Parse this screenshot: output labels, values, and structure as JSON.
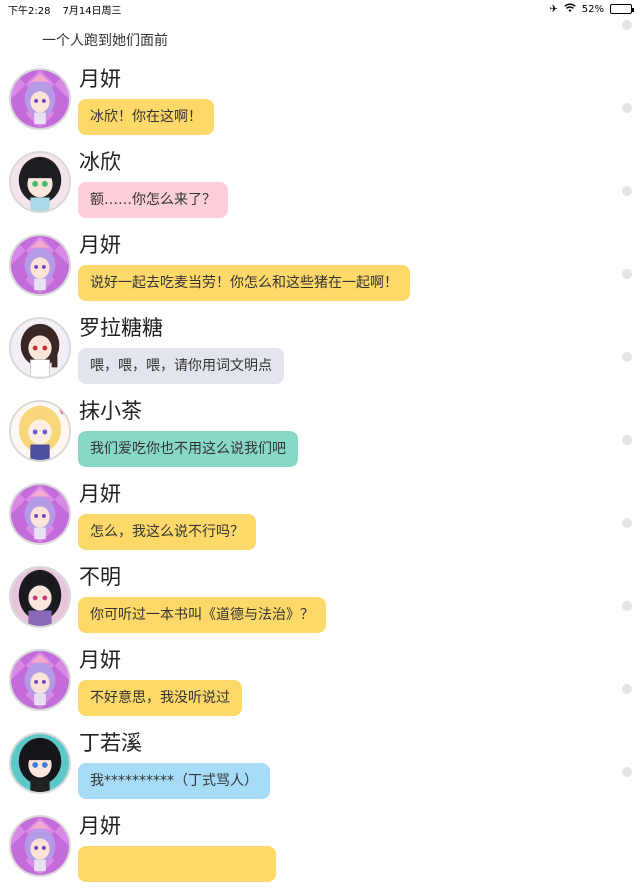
{
  "status_bar": {
    "time": "下午2:28",
    "date": "7月14日周三",
    "battery": "52%",
    "battery_level": 0.52
  },
  "narration": "一个人跑到她们面前",
  "colors": {
    "yellow": "#fdd96a",
    "pink": "#fccfda",
    "gray": "#e2e5ec",
    "teal": "#88d8c8",
    "blue": "#a6dcf8"
  },
  "messages": [
    {
      "name": "月妍",
      "text": "冰欣！你在这啊！",
      "bubble_color": "#fdd96a",
      "avatar": "purple-hair-avatar"
    },
    {
      "name": "冰欣",
      "text": "额……你怎么来了？",
      "bubble_color": "#fccfda",
      "avatar": "black-hair-avatar"
    },
    {
      "name": "月妍",
      "text": "说好一起去吃麦当劳！你怎么和这些猪在一起啊！",
      "bubble_color": "#fdd96a",
      "avatar": "purple-hair-avatar"
    },
    {
      "name": "罗拉糖糖",
      "text": "喂，喂，喂，请你用词文明点",
      "bubble_color": "#e2e5ec",
      "avatar": "brown-hair-avatar"
    },
    {
      "name": "抹小茶",
      "text": "我们爱吃你也不用这么说我们吧",
      "bubble_color": "#88d8c8",
      "avatar": "blonde-hair-avatar"
    },
    {
      "name": "月妍",
      "text": "怎么，我这么说不行吗？",
      "bubble_color": "#fdd96a",
      "avatar": "purple-hair-avatar"
    },
    {
      "name": "不明",
      "text": "你可听过一本书叫《道德与法治》？",
      "bubble_color": "#fdd96a",
      "avatar": "dark-hair-avatar"
    },
    {
      "name": "月妍",
      "text": "不好意思，我没听说过",
      "bubble_color": "#fdd96a",
      "avatar": "purple-hair-avatar"
    },
    {
      "name": "丁若溪",
      "text": "我**********（丁式骂人）",
      "bubble_color": "#a6dcf8",
      "avatar": "teal-bg-avatar"
    },
    {
      "name": "月妍",
      "text": "",
      "bubble_color": "#fdd96a",
      "avatar": "purple-hair-avatar"
    }
  ]
}
